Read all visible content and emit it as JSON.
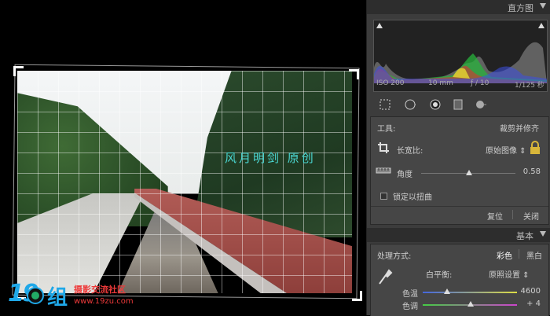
{
  "canvas": {
    "watermark": "风月明剑 原创",
    "logo_num": "19",
    "logo_text": "摄影交流社区",
    "logo_url": "www.19zu.com"
  },
  "histogram": {
    "title": "直方图",
    "iso": "ISO 200",
    "focal": "10 mm",
    "aperture": "ƒ / 10",
    "shutter": "1/125 秒"
  },
  "crop": {
    "tool_label": "工具:",
    "tool_name": "裁剪并修齐",
    "aspect_label": "长宽比:",
    "aspect_value": "原始图像 ⇕",
    "angle_label": "角度",
    "angle_value": "0.58",
    "angle_slider": 0.58,
    "constrain_label": "锁定以扭曲",
    "reset_label": "复位",
    "close_label": "关闭"
  },
  "basic": {
    "title": "基本",
    "treatment_label": "处理方式:",
    "color": "彩色",
    "bw": "黑白",
    "wb_label": "白平衡:",
    "wb_value": "原照设置 ⇕",
    "temp_label": "色温",
    "temp_value": "4600",
    "tint_label": "色调",
    "tint_value": "+ 4"
  },
  "colors": {
    "accent": "#4ad7d3",
    "panel": "#3c3c3c",
    "header": "#2d2d2d"
  }
}
